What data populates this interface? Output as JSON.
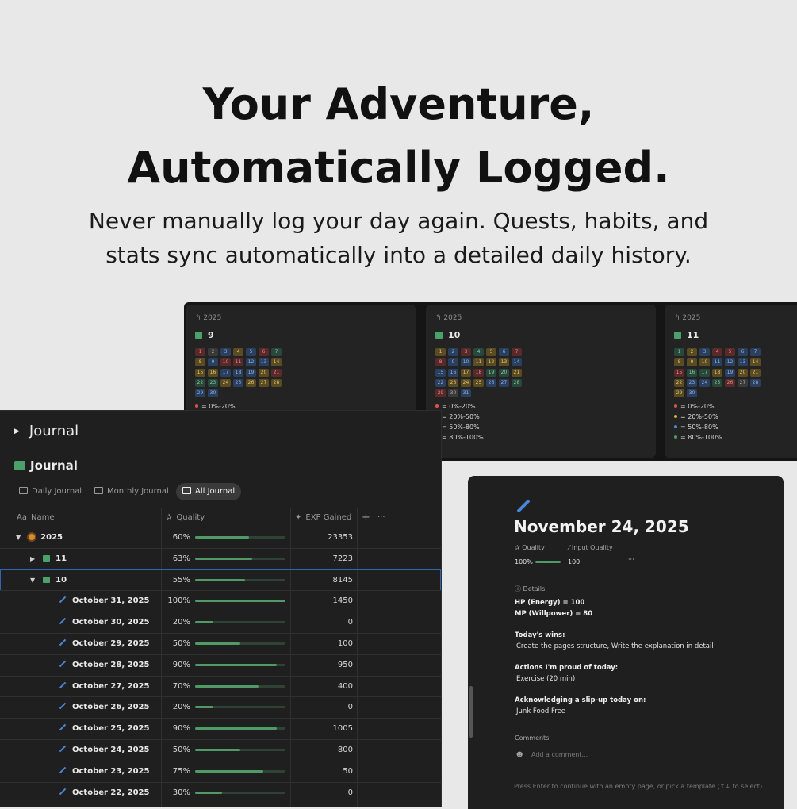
{
  "hero": {
    "title_line1": "Your Adventure,",
    "title_line2": "Automatically Logged.",
    "subtitle_line1": "Never manually log your day again. Quests, habits, and",
    "subtitle_line2": "stats sync automatically into a detailed daily history."
  },
  "calendars": [
    {
      "crumb": "2025",
      "title": "9",
      "days": [
        1,
        2,
        3,
        4,
        5,
        6,
        7,
        8,
        9,
        10,
        11,
        12,
        13,
        14,
        15,
        16,
        17,
        18,
        19,
        20,
        21,
        22,
        23,
        24,
        25,
        26,
        27,
        28,
        29,
        30
      ]
    },
    {
      "crumb": "2025",
      "title": "10",
      "days": [
        1,
        2,
        3,
        4,
        5,
        6,
        7,
        8,
        9,
        10,
        11,
        12,
        13,
        14,
        15,
        16,
        17,
        18,
        19,
        20,
        21,
        22,
        23,
        24,
        25,
        26,
        27,
        28,
        29,
        30,
        31
      ]
    },
    {
      "crumb": "2025",
      "title": "11",
      "days": [
        1,
        2,
        3,
        4,
        5,
        6,
        7,
        8,
        9,
        10,
        11,
        12,
        13,
        14,
        15,
        16,
        17,
        18,
        19,
        20,
        21,
        22,
        23,
        24,
        25,
        26,
        27,
        28,
        29,
        30
      ]
    }
  ],
  "legend": [
    {
      "label": "= 0%-20%",
      "color": "#d9534f"
    },
    {
      "label": "= 20%-50%",
      "color": "#e0b040"
    },
    {
      "label": "= 50%-80%",
      "color": "#4a86d6"
    },
    {
      "label": "= 80%-100%",
      "color": "#4f9a67"
    }
  ],
  "journal": {
    "toggle_label": "Journal",
    "db_title": "Journal",
    "tabs": [
      "Daily Journal",
      "Monthly Journal",
      "All Journal"
    ],
    "columns": {
      "name": "Name",
      "quality": "Quality",
      "exp": "EXP Gained",
      "name_icon": "Aa",
      "add": "+",
      "more": "···"
    },
    "rows": [
      {
        "name": "2025",
        "pct": "60%",
        "q": 0.6,
        "exp": "23353",
        "kind": "year"
      },
      {
        "name": "11",
        "pct": "63%",
        "q": 0.63,
        "exp": "7223",
        "kind": "month"
      },
      {
        "name": "10",
        "pct": "55%",
        "q": 0.55,
        "exp": "8145",
        "kind": "month-open"
      },
      {
        "name": "October 31, 2025",
        "pct": "100%",
        "q": 1.0,
        "exp": "1450",
        "kind": "day"
      },
      {
        "name": "October 30, 2025",
        "pct": "20%",
        "q": 0.2,
        "exp": "0",
        "kind": "day"
      },
      {
        "name": "October 29, 2025",
        "pct": "50%",
        "q": 0.5,
        "exp": "100",
        "kind": "day"
      },
      {
        "name": "October 28, 2025",
        "pct": "90%",
        "q": 0.9,
        "exp": "950",
        "kind": "day"
      },
      {
        "name": "October 27, 2025",
        "pct": "70%",
        "q": 0.7,
        "exp": "400",
        "kind": "day"
      },
      {
        "name": "October 26, 2025",
        "pct": "20%",
        "q": 0.2,
        "exp": "0",
        "kind": "day"
      },
      {
        "name": "October 25, 2025",
        "pct": "90%",
        "q": 0.9,
        "exp": "1005",
        "kind": "day"
      },
      {
        "name": "October 24, 2025",
        "pct": "50%",
        "q": 0.5,
        "exp": "800",
        "kind": "day"
      },
      {
        "name": "October 23, 2025",
        "pct": "75%",
        "q": 0.75,
        "exp": "50",
        "kind": "day"
      },
      {
        "name": "October 22, 2025",
        "pct": "30%",
        "q": 0.3,
        "exp": "0",
        "kind": "day"
      }
    ]
  },
  "page": {
    "title": "November 24, 2025",
    "prop_quality": "Quality",
    "prop_input": "Input Quality",
    "quality_val": "100%",
    "quality_fill": 1.0,
    "input_val": "100",
    "more": "···",
    "details_label": "Details",
    "hp": "HP (Energy) = 100",
    "mp": "MP (Willpower) = 80",
    "wins_h": "Today's wins:",
    "wins": "Create the pages structure, Write the explanation in detail",
    "proud_h": "Actions I'm proud of today:",
    "proud": "Exercise (20 min)",
    "slip_h": "Acknowledging a slip-up today on:",
    "slip": "Junk Food Free",
    "comments_h": "Comments",
    "comment_placeholder": "Add a comment...",
    "hint": "Press Enter to continue with an empty page, or pick a template (↑↓ to select)"
  }
}
